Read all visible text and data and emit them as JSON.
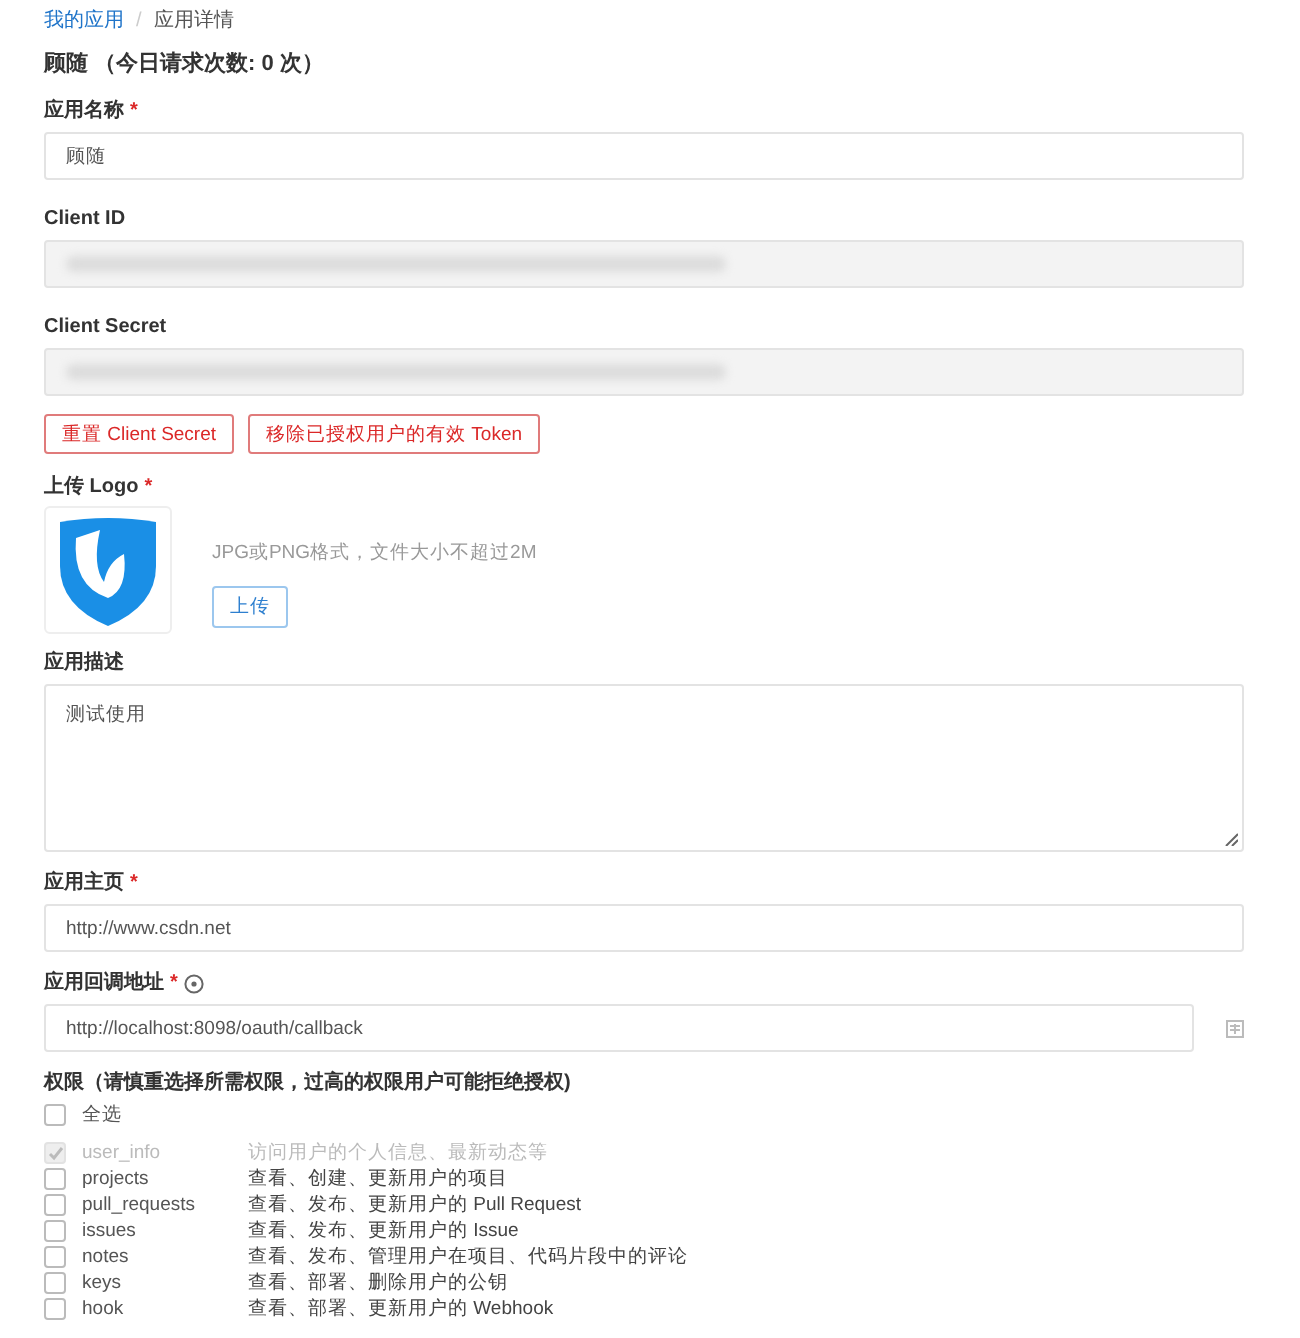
{
  "breadcrumb": [
    {
      "label": "我的应用",
      "kind": "link"
    },
    {
      "label": "应用详情",
      "kind": "current"
    }
  ],
  "breadcrumb_separator": "/",
  "title": "顾随 （今日请求次数: 0 次）",
  "fields": [
    {
      "kind": "input",
      "label": "应用名称",
      "required_mark": "*",
      "value": "顾随"
    },
    {
      "kind": "masked",
      "label": "Client ID"
    },
    {
      "kind": "masked",
      "label": "Client Secret"
    }
  ],
  "actions": [
    "重置 Client Secret",
    "移除已授权用户的有效 Token"
  ],
  "logo": {
    "label": "上传 Logo",
    "required_mark": "*",
    "hint": "JPG或PNG格式，文件大小不超过2M",
    "button": "上传"
  },
  "description": {
    "label": "应用描述",
    "value": "测试使用"
  },
  "homepage": {
    "label": "应用主页",
    "required_mark": "*",
    "value": "http://www.csdn.net"
  },
  "callback": {
    "label": "应用回调地址",
    "required_mark": "*",
    "value": "http://localhost:8098/oauth/callback"
  },
  "permissions": {
    "label": "权限（请慎重选择所需权限，过高的权限用户可能拒绝授权)",
    "select_all": {
      "label": "全选",
      "checked": false
    },
    "items": [
      {
        "name": "user_info",
        "description": "访问用户的个人信息、最新动态等",
        "checked": true,
        "disabled": true
      },
      {
        "name": "projects",
        "description": "查看、创建、更新用户的项目",
        "checked": false,
        "disabled": false
      },
      {
        "name": "pull_requests",
        "description": "查看、发布、更新用户的 Pull Request",
        "checked": false,
        "disabled": false
      },
      {
        "name": "issues",
        "description": "查看、发布、更新用户的 Issue",
        "checked": false,
        "disabled": false
      },
      {
        "name": "notes",
        "description": "查看、发布、管理用户在项目、代码片段中的评论",
        "checked": false,
        "disabled": false
      },
      {
        "name": "keys",
        "description": "查看、部署、删除用户的公钥",
        "checked": false,
        "disabled": false
      },
      {
        "name": "hook",
        "description": "查看、部署、更新用户的 Webhook",
        "checked": false,
        "disabled": false
      }
    ]
  }
}
